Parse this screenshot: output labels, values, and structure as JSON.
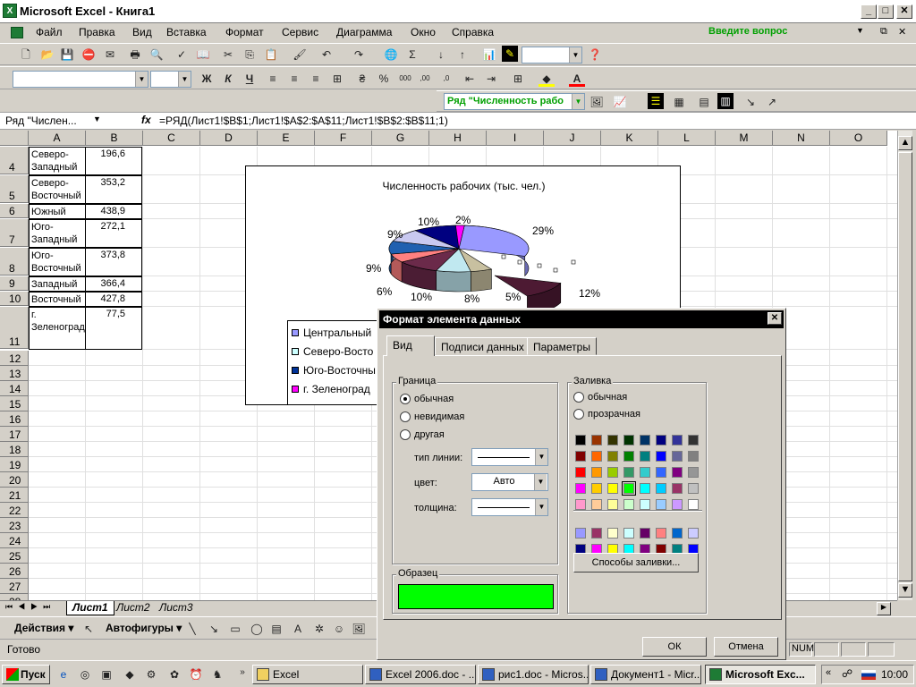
{
  "window": {
    "title": "Microsoft Excel - Книга1",
    "app_icon": "excel-icon"
  },
  "menu": [
    "Файл",
    "Правка",
    "Вид",
    "Вставка",
    "Формат",
    "Сервис",
    "Диаграмма",
    "Окно",
    "Справка"
  ],
  "help_box": "Введите вопрос",
  "chart_toolbar": {
    "selector": "Ряд \"Численность рабо"
  },
  "formula": {
    "namebox": "Ряд \"Числен...",
    "fx": "fx",
    "content": "=РЯД(Лист1!$B$1;Лист1!$A$2:$A$11;Лист1!$B$2:$B$11;1)"
  },
  "columns": [
    "A",
    "B",
    "C",
    "D",
    "E",
    "F",
    "G",
    "H",
    "I",
    "J",
    "K",
    "L",
    "M",
    "N",
    "O"
  ],
  "rows": [
    {
      "n": "4",
      "name": "Северо-\nЗападный",
      "value": "196,6"
    },
    {
      "n": "5",
      "name": "Северо-\nВосточный",
      "value": "353,2"
    },
    {
      "n": "6",
      "name": "Южный",
      "value": "438,9"
    },
    {
      "n": "7",
      "name": "Юго-\nЗападный",
      "value": "272,1"
    },
    {
      "n": "8",
      "name": "Юго-\nВосточный",
      "value": "373,8"
    },
    {
      "n": "9",
      "name": "Западный",
      "value": "366,4"
    },
    {
      "n": "10",
      "name": "Восточный",
      "value": "427,8"
    },
    {
      "n": "11",
      "name": "г.\nЗеленоград",
      "value": "77,5"
    }
  ],
  "empty_rows": [
    "12",
    "13",
    "14",
    "15",
    "16",
    "17",
    "18",
    "19",
    "20",
    "21",
    "22",
    "23",
    "24",
    "25",
    "26",
    "27",
    "28"
  ],
  "chart": {
    "title": "Численность рабочих (тыс. чел.)",
    "percent_labels": [
      "29%",
      "12%",
      "5%",
      "8%",
      "10%",
      "6%",
      "9%",
      "9%",
      "10%",
      "2%"
    ],
    "legend": [
      "Центральный",
      "Северо-Восто",
      "Юго-Восточны",
      "г. Зеленоград"
    ],
    "legend_colors": [
      "#9999ff",
      "#ccffff",
      "#003399",
      "#ff00ff"
    ],
    "slice_colors": [
      "#9999ff",
      "#4d1a33",
      "#c8c0a0",
      "#c0e8f0",
      "#6b2a4a",
      "#ff8080",
      "#2060b0",
      "#c8c8f0",
      "#000080",
      "#ff00ff"
    ]
  },
  "sheets": [
    "Лист1",
    "Лист2",
    "Лист3"
  ],
  "drawing": {
    "actions": "Действия",
    "autoshapes": "Автофигуры"
  },
  "status": {
    "ready": "Готово",
    "num": "NUM"
  },
  "dialog": {
    "title": "Формат элемента данных",
    "tabs": [
      "Вид",
      "Подписи данных",
      "Параметры"
    ],
    "border_group": "Граница",
    "border_options": [
      "обычная",
      "невидимая",
      "другая"
    ],
    "line_type_label": "тип линии:",
    "color_label": "цвет:",
    "color_value": "Авто",
    "thickness_label": "толщина:",
    "fill_group": "Заливка",
    "fill_options": [
      "обычная",
      "прозрачная"
    ],
    "fill_methods": "Способы заливки...",
    "sample_group": "Образец",
    "sample_color": "#00ff00",
    "ok": "ОК",
    "cancel": "Отмена",
    "palette": [
      [
        "#000000",
        "#993300",
        "#333300",
        "#003300",
        "#003366",
        "#000080",
        "#333399",
        "#333333"
      ],
      [
        "#800000",
        "#ff6600",
        "#808000",
        "#008000",
        "#008080",
        "#0000ff",
        "#666699",
        "#808080"
      ],
      [
        "#ff0000",
        "#ff9900",
        "#99cc00",
        "#339966",
        "#33cccc",
        "#3366ff",
        "#800080",
        "#969696"
      ],
      [
        "#ff00ff",
        "#ffcc00",
        "#ffff00",
        "#00ff00",
        "#00ffff",
        "#00ccff",
        "#993366",
        "#c0c0c0"
      ],
      [
        "#ff99cc",
        "#ffcc99",
        "#ffff99",
        "#ccffcc",
        "#ccffff",
        "#99ccff",
        "#cc99ff",
        "#ffffff"
      ]
    ],
    "palette2": [
      [
        "#9999ff",
        "#993366",
        "#ffffcc",
        "#ccffff",
        "#660066",
        "#ff8080",
        "#0066cc",
        "#ccccff"
      ],
      [
        "#000080",
        "#ff00ff",
        "#ffff00",
        "#00ffff",
        "#800080",
        "#800000",
        "#008080",
        "#0000ff"
      ]
    ]
  },
  "taskbar": {
    "start": "Пуск",
    "tasks": [
      "Excel",
      "Excel 2006.doc - ...",
      "рис1.doc - Micros...",
      "Документ1 - Micr...",
      "Microsoft Exc..."
    ],
    "clock": "10:00"
  }
}
